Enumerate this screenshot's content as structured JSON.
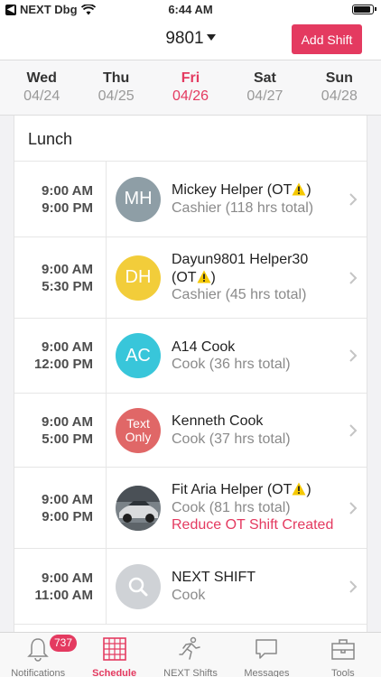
{
  "status_bar": {
    "carrier": "NEXT Dbg",
    "time": "6:44 AM"
  },
  "header": {
    "store": "9801",
    "add_shift_label": "Add Shift"
  },
  "days": [
    {
      "name": "Wed",
      "date": "04/24",
      "active": false
    },
    {
      "name": "Thu",
      "date": "04/25",
      "active": false
    },
    {
      "name": "Fri",
      "date": "04/26",
      "active": true
    },
    {
      "name": "Sat",
      "date": "04/27",
      "active": false
    },
    {
      "name": "Sun",
      "date": "04/28",
      "active": false
    }
  ],
  "section_title": "Lunch",
  "shifts": [
    {
      "start": "9:00 AM",
      "end": "9:00 PM",
      "initials": "MH",
      "avatar_color": "#8e9ea6",
      "name": "Mickey Helper (OT",
      "name_suffix": ")",
      "role": "Cashier (118 hrs total)"
    },
    {
      "start": "9:00 AM",
      "end": "5:30 PM",
      "initials": "DH",
      "avatar_color": "#f2cd3a",
      "name_line1": "Dayun9801 Helper30",
      "name": "(OT",
      "name_suffix": ")",
      "role": "Cashier (45 hrs total)"
    },
    {
      "start": "9:00 AM",
      "end": "12:00 PM",
      "initials": "AC",
      "avatar_color": "#38c6da",
      "name": "A14 Cook",
      "role": "Cook (36 hrs total)"
    },
    {
      "start": "9:00 AM",
      "end": "5:00 PM",
      "initials_line1": "Text",
      "initials_line2": "Only",
      "avatar_color": "#e06767",
      "name": "Kenneth Cook",
      "role": "Cook (37 hrs total)"
    },
    {
      "start": "9:00 AM",
      "end": "9:00 PM",
      "avatar": "car-photo",
      "name": "Fit Aria Helper (OT",
      "name_suffix": ")",
      "role": "Cook (81 hrs total)",
      "alert": "Reduce OT Shift Created"
    },
    {
      "start": "9:00 AM",
      "end": "11:00 AM",
      "avatar": "search-icon",
      "avatar_color": "#cfd2d6",
      "name": "NEXT SHIFT",
      "role": "Cook"
    }
  ],
  "tabs": [
    {
      "label": "Notifications",
      "icon": "bell-icon",
      "badge": "737"
    },
    {
      "label": "Schedule",
      "icon": "calendar-icon",
      "active": true
    },
    {
      "label": "NEXT Shifts",
      "icon": "runner-icon"
    },
    {
      "label": "Messages",
      "icon": "chat-icon"
    },
    {
      "label": "Tools",
      "icon": "toolbox-icon"
    }
  ],
  "colors": {
    "accent": "#e43a60",
    "muted_text": "#8a8a8a",
    "ot_warning": "#f5c800"
  }
}
